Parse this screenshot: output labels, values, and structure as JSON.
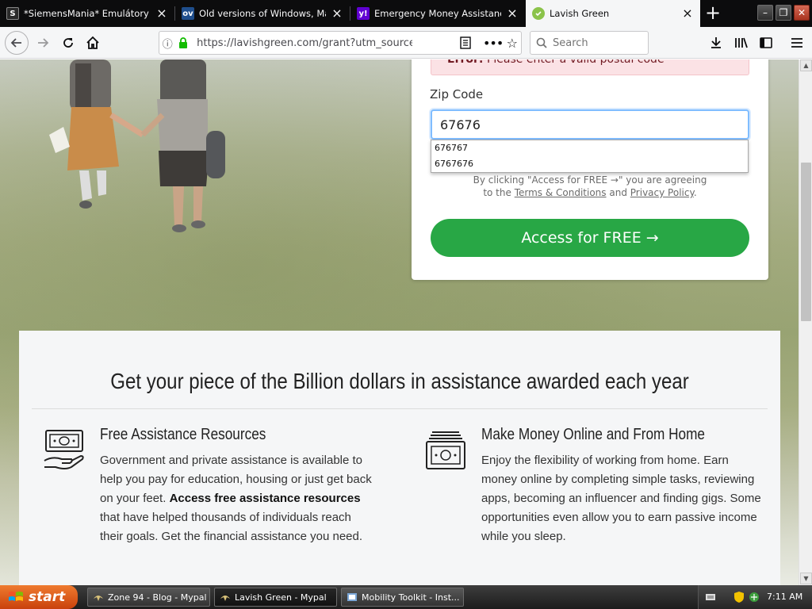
{
  "browser": {
    "tabs": [
      {
        "title": "*SiemensMania* Emulátory",
        "favicon_text": "S",
        "favicon_color": "#2b2b2b",
        "active": false
      },
      {
        "title": "Old versions of Windows, Mac and",
        "favicon_text": "ov",
        "favicon_color": "#1f4e8c",
        "active": false
      },
      {
        "title": "Emergency Money Assistance - Y",
        "favicon_text": "y!",
        "favicon_color": "#6001d2",
        "active": false
      },
      {
        "title": "Lavish Green",
        "favicon_text": "",
        "favicon_color": "#8bc34a",
        "active": true
      }
    ],
    "url": "https://lavishgreen.com/grant?utm_source=bing",
    "search_placeholder": "Search"
  },
  "form": {
    "error_prefix": "Error:",
    "error_text": "Please enter a valid postal code",
    "zip_label": "Zip Code",
    "zip_value": "67676",
    "autocomplete": [
      "676767",
      "6767676"
    ],
    "consent_prefix": "By clicking \"Access for FREE →\" you are agreeing",
    "consent_to_the": "to the",
    "terms_link": "Terms & Conditions",
    "consent_and": "and",
    "privacy_link": "Privacy Policy",
    "consent_period": ".",
    "cta_label": "Access for FREE →",
    "cta_color": "#28a745"
  },
  "info": {
    "heading": "Get your piece of the Billion dollars in assistance awarded each year",
    "features": [
      {
        "icon": "hand-money-icon",
        "title": "Free Assistance Resources",
        "text_before": "Government and private assistance is available to help you pay for education, housing or just get back on your feet.",
        "text_bold": "Access free assistance resources",
        "text_after": "that have helped thousands of individuals reach their goals. Get the financial assistance you need."
      },
      {
        "icon": "cash-stack-icon",
        "title": "Make Money Online and From Home",
        "text": "Enjoy the flexibility of working from home. Earn money online by completing simple tasks, reviewing apps, becoming an influencer and finding gigs. Some opportunities even allow you to earn passive income while you sleep."
      }
    ]
  },
  "taskbar": {
    "start_label": "start",
    "tasks": [
      "Zone 94 - Blog - Mypal",
      "Lavish Green - Mypal",
      "Mobility Toolkit - Inst..."
    ],
    "clock": "7:11 AM"
  }
}
